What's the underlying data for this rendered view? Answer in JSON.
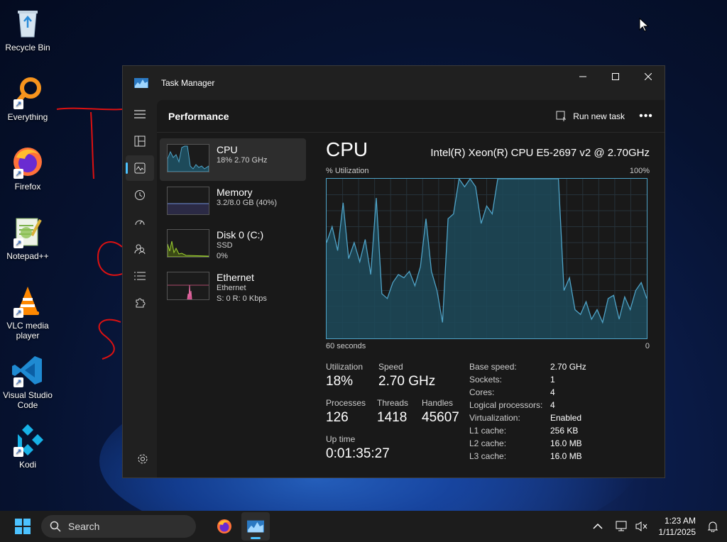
{
  "desktop": {
    "icons": [
      {
        "label": "Recycle Bin"
      },
      {
        "label": "Everything"
      },
      {
        "label": "Firefox"
      },
      {
        "label": "Notepad++"
      },
      {
        "label": "VLC media player"
      },
      {
        "label": "Visual Studio Code"
      },
      {
        "label": "Kodi"
      }
    ]
  },
  "window": {
    "title": "Task Manager",
    "page_title": "Performance",
    "run_new_task": "Run new task",
    "more": "•••"
  },
  "devices": [
    {
      "name": "CPU",
      "sub1": "18% 2.70 GHz",
      "sub2": "",
      "sub3": ""
    },
    {
      "name": "Memory",
      "sub1": "3.2/8.0 GB (40%)",
      "sub2": "",
      "sub3": ""
    },
    {
      "name": "Disk 0 (C:)",
      "sub1": "SSD",
      "sub2": "0%",
      "sub3": ""
    },
    {
      "name": "Ethernet",
      "sub1": "Ethernet",
      "sub2": "S: 0 R: 0 Kbps",
      "sub3": ""
    }
  ],
  "detail": {
    "heading": "CPU",
    "cpu_name": "Intel(R) Xeon(R) CPU E5-2697 v2 @ 2.70GHz",
    "axis_label": "% Utilization",
    "axis_max": "100%",
    "axis_time": "60 seconds",
    "axis_min": "0",
    "stats": {
      "utilization_label": "Utilization",
      "utilization": "18%",
      "speed_label": "Speed",
      "speed": "2.70 GHz",
      "processes_label": "Processes",
      "processes": "126",
      "threads_label": "Threads",
      "threads": "1418",
      "handles_label": "Handles",
      "handles": "45607",
      "uptime_label": "Up time",
      "uptime": "0:01:35:27"
    },
    "props": [
      {
        "k": "Base speed:",
        "v": "2.70 GHz"
      },
      {
        "k": "Sockets:",
        "v": "1"
      },
      {
        "k": "Cores:",
        "v": "4"
      },
      {
        "k": "Logical processors:",
        "v": "4"
      },
      {
        "k": "Virtualization:",
        "v": "Enabled"
      },
      {
        "k": "L1 cache:",
        "v": "256 KB"
      },
      {
        "k": "L2 cache:",
        "v": "16.0 MB"
      },
      {
        "k": "L3 cache:",
        "v": "16.0 MB"
      }
    ],
    "cpu_history": [
      60,
      70,
      55,
      85,
      50,
      60,
      48,
      62,
      40,
      88,
      28,
      25,
      35,
      40,
      38,
      42,
      33,
      45,
      75,
      42,
      30,
      10,
      75,
      78,
      100,
      95,
      100,
      95,
      72,
      83,
      78,
      100,
      100,
      100,
      100,
      100,
      100,
      100,
      100,
      100,
      100,
      100,
      100,
      30,
      38,
      18,
      15,
      23,
      12,
      18,
      10,
      25,
      27,
      12,
      26,
      18,
      30,
      35,
      25
    ],
    "graph_color": "#4fa3c7"
  },
  "taskbar": {
    "search_placeholder": "Search",
    "time": "1:23 AM",
    "date": "1/11/2025"
  }
}
